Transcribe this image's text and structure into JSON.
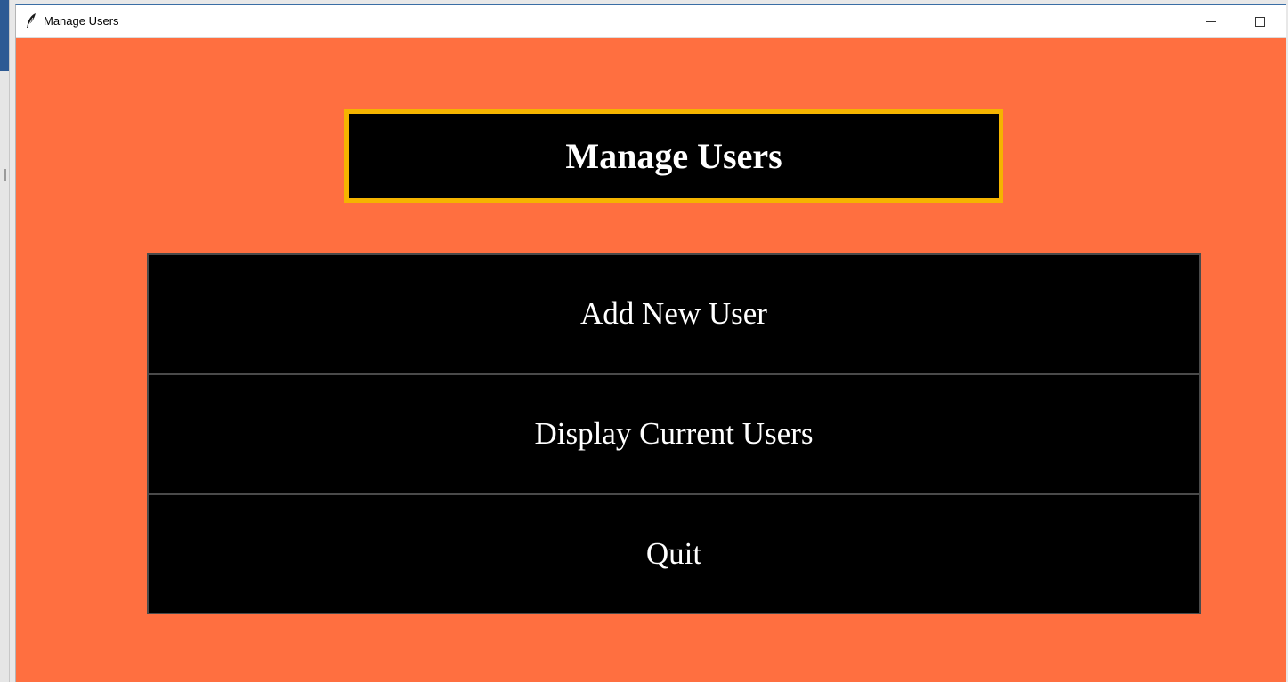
{
  "window": {
    "title": "Manage Users",
    "app_icon": "feather-icon",
    "controls": [
      "minimize-icon",
      "maximize-icon"
    ]
  },
  "colors": {
    "background": "#ff6f40",
    "heading_border": "#f5b400",
    "button_background": "#000000",
    "text": "#ffffff"
  },
  "main": {
    "heading": "Manage Users",
    "buttons": [
      {
        "label": "Add New User"
      },
      {
        "label": "Display Current Users"
      },
      {
        "label": "Quit"
      }
    ]
  }
}
